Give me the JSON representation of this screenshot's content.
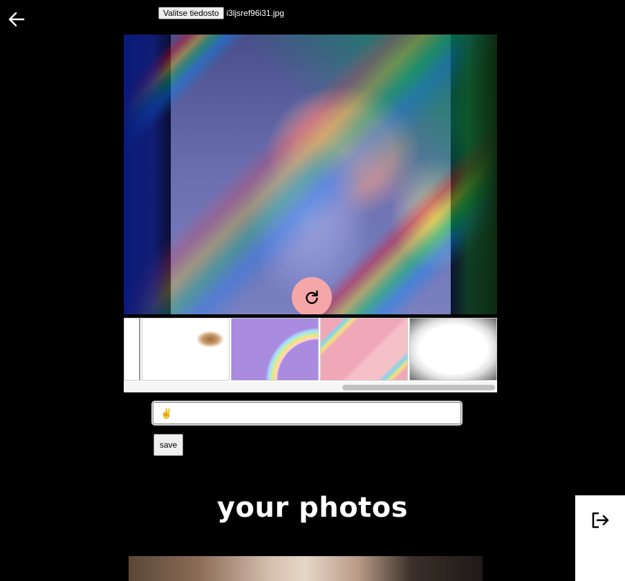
{
  "header": {
    "file_button": "Valitse tiedosto",
    "file_name": "i3ljsref96i31.jpg"
  },
  "editor": {
    "rotate_icon": "rotate-icon",
    "filters": [
      {
        "name": "partial-filter"
      },
      {
        "name": "flying-squirrel-filter"
      },
      {
        "name": "purple-rainbow-filter"
      },
      {
        "name": "pastel-stripes-filter"
      },
      {
        "name": "vignette-filter"
      }
    ]
  },
  "caption": {
    "value": "✌"
  },
  "save_label": "save",
  "gallery": {
    "title": "your photos"
  },
  "icons": {
    "back": "arrow-left-icon",
    "logout": "logout-icon"
  }
}
